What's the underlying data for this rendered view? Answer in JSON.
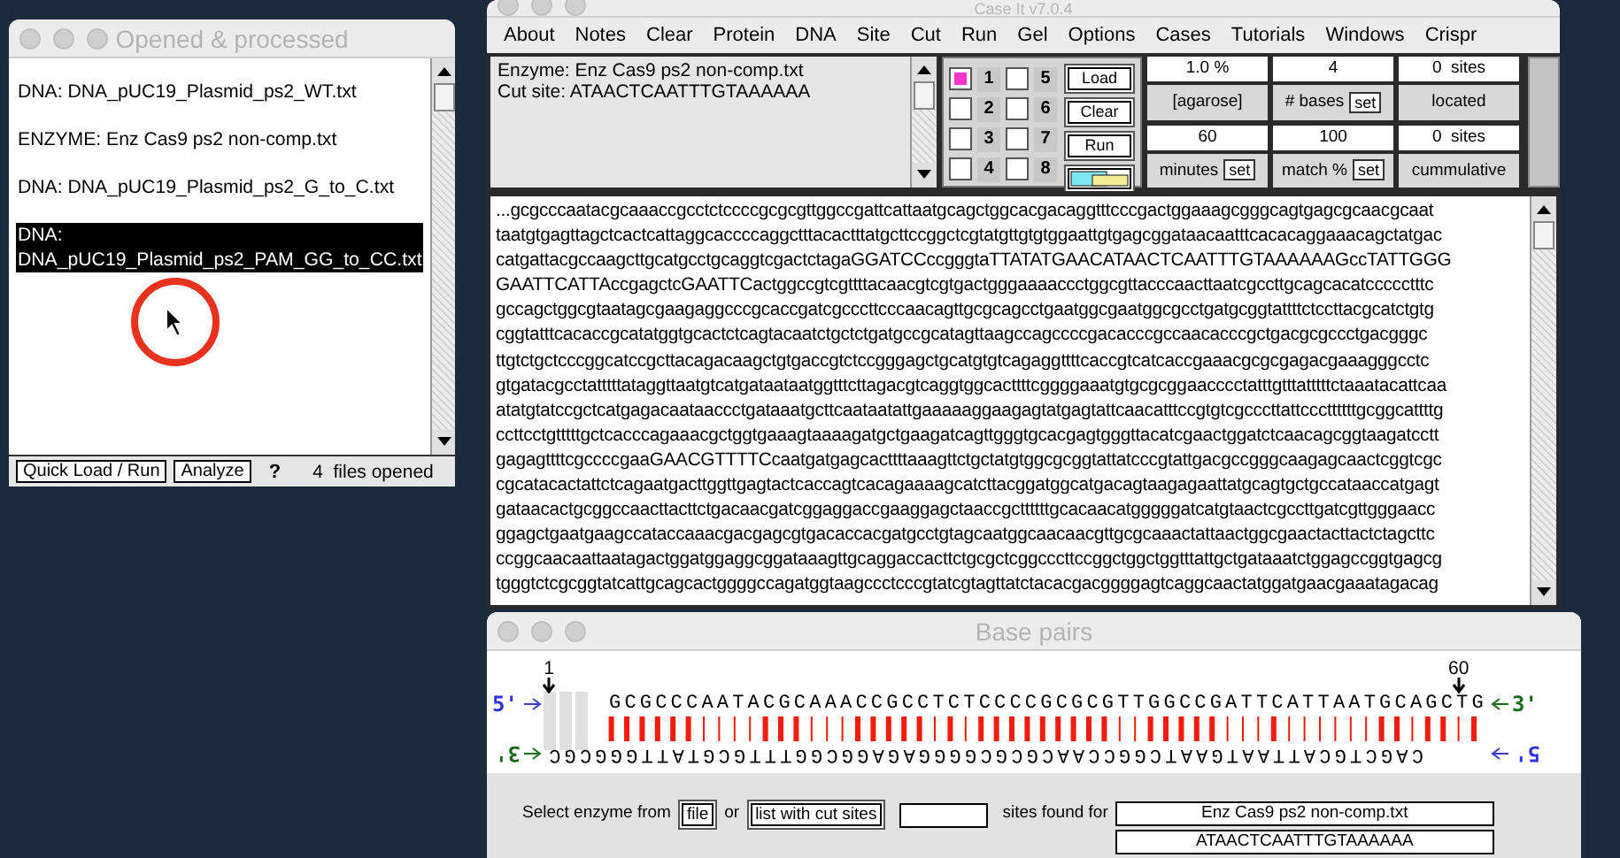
{
  "left_window": {
    "title": "Opened & processed",
    "items": [
      {
        "text": "DNA: DNA_pUC19_Plasmid_ps2_WT.txt",
        "selected": false
      },
      {
        "text": "ENZYME: Enz Cas9 ps2 non-comp.txt",
        "selected": false
      },
      {
        "text": "DNA: DNA_pUC19_Plasmid_ps2_G_to_C.txt",
        "selected": false
      },
      {
        "text": "DNA: DNA_pUC19_Plasmid_ps2_PAM_GG_to_CC.txt",
        "selected": true
      }
    ],
    "buttons": [
      "Quick Load / Run",
      "Analyze"
    ],
    "help": "?",
    "status": "4  files opened"
  },
  "main_window": {
    "title": "Case It v7.0.4",
    "menu": [
      "About",
      "Notes",
      "Clear",
      "Protein",
      "DNA",
      "Site",
      "Cut",
      "Run",
      "Gel",
      "Options",
      "Cases",
      "Tutorials",
      "Windows",
      "Crispr"
    ],
    "enzyme_info": [
      "Enzyme: Enz Cas9 ps2 non-comp.txt",
      "Cut site: ATAACTCAATTTGTAAAAAA"
    ],
    "lanes": [
      {
        "label": "1",
        "checked": true
      },
      {
        "label": "5",
        "checked": false
      },
      {
        "label": "2",
        "checked": false
      },
      {
        "label": "6",
        "checked": false
      },
      {
        "label": "3",
        "checked": false
      },
      {
        "label": "7",
        "checked": false
      },
      {
        "label": "4",
        "checked": false
      },
      {
        "label": "8",
        "checked": false
      }
    ],
    "lane_buttons": [
      "Load",
      "Clear",
      "Run"
    ],
    "params": [
      {
        "value": "1.0 %",
        "label": "[agarose]"
      },
      {
        "value": "4",
        "label": "# bases",
        "set_button": "set"
      },
      {
        "value": "0  sites",
        "label": "located"
      },
      {
        "value": "60",
        "label": "minutes",
        "set_button": "set"
      },
      {
        "value": "100",
        "label": "match %",
        "set_button": "set"
      },
      {
        "value": "0  sites",
        "label": "cummulative"
      }
    ],
    "sequence_lines": [
      "...gcgcccaatacgcaaaccgcctctccccgcgcgttggccgattcattaatgcagctggcacgacaggtttcccgactggaaagcgggcagtgagcgcaacgcaat",
      "taatgtgagttagctcactcattaggcaccccaggctttacactttatgcttccggctcgtatgttgtgtggaattgtgagcggataacaatttcacacaggaaacagctatgac",
      "catgattacgccaagcttgcatgcctgcaggtcgactctagaGGATCCccgggtaTTATATGAACATAACTCAATTTGTAAAAAAGccTATTGGG",
      "GAATTCATTAccgagctcGAATTCactggccgtcgttttacaacgtcgtgactgggaaaaccctggcgttacccaacttaatcgccttgcagcacatccccctttc",
      "gccagctggcgtaatagcgaagaggcccgcaccgatcgcccttcccaacagttgcgcagcctgaatggcgaatggcgcctgatgcggtattttctccttacgcatctgtg",
      "cggtatttcacaccgcatatggtgcactctcagtacaatctgctctgatgccgcatagttaagccagccccgacacccgccaacacccgctgacgcgccctgacgggc",
      "ttgtctgctcccggcatccgcttacagacaagctgtgaccgtctccgggagctgcatgtgtcagaggttttcaccgtcatcaccgaaacgcgcgagacgaaagggcctc",
      "gtgatacgcctatttttataggttaatgtcatgataataatggtttcttagacgtcaggtggcacttttcggggaaatgtgcgcggaacccctatttgtttatttttctaaatacattcaa",
      "atatgtatccgctcatgagacaataaccctgataaatgcttcaataatattgaaaaaggaagagtatgagtattcaacatttccgtgtcgcccttattcccttttttgcggcattttg",
      "ccttcctgtttttgctcacccagaaacgctggtgaaagtaaaagatgctgaagatcagttgggtgcacgagtgggttacatcgaactggatctcaacagcggtaagatcctt",
      "gagagttttcgccccgaaGAACGTTTTCcaatgatgagcacttttaaagttctgctatgtggcgcggtattatcccgtattgacgccgggcaagagcaactcggtcgc",
      "cgcatacactattctcagaatgacttggttgagtactcaccagtcacagaaaagcatcttacggatggcatgacagtaagagaattatgcagtgctgccataaccatgagt",
      "gataacactgcggccaacttacttctgacaacgatcggaggaccgaaggagctaaccgcttttttgcacaacatgggggatcatgtaactcgccttgatcgttgggaacc",
      "ggagctgaatgaagccataccaaacgacgagcgtgacaccacgatgcctgtagcaatggcaacaacgttgcgcaaactattaactggcgaactacttactctagcttc",
      "ccggcaacaattaatagactggatggaggcggataaagttgcaggaccacttctgcgctcggcccttccggctggctggtttattgctgataaatctggagccggtgagcg",
      "tgggtctcgcggtatcattgcagcactggggccagatggtaagccctcccgtatcgtagttatctacacgacggggagtcaggcaactatggatgaacgaaatagacag"
    ]
  },
  "base_pairs": {
    "title": "Base pairs",
    "start_marker": "1",
    "end_marker": "60",
    "top_strand": {
      "five_prime": "5'",
      "sequence": "GCGCCCAATACGCAAACCGCCTCTCCCCGCGCGTTGGCCGATTCATTAATGCAGCTG",
      "three_prime": "3'"
    },
    "bottom_strand": {
      "five_prime": "5'",
      "sequence": "CAGCTGCATTAATGAATCGGCCAACGCGCGGGGAGAGGCGGTTTGCGTATTGGGCGC",
      "three_prime": "3'"
    },
    "select_label": "Select enzyme from",
    "file_button": "file",
    "or_label": "or",
    "list_button": "list with cut sites",
    "sites_found_label": "sites found for",
    "enzyme_name": "Enz Cas9 ps2 non-comp.txt",
    "cut_site": "ATAACTCAATTTGTAAAAAA"
  }
}
